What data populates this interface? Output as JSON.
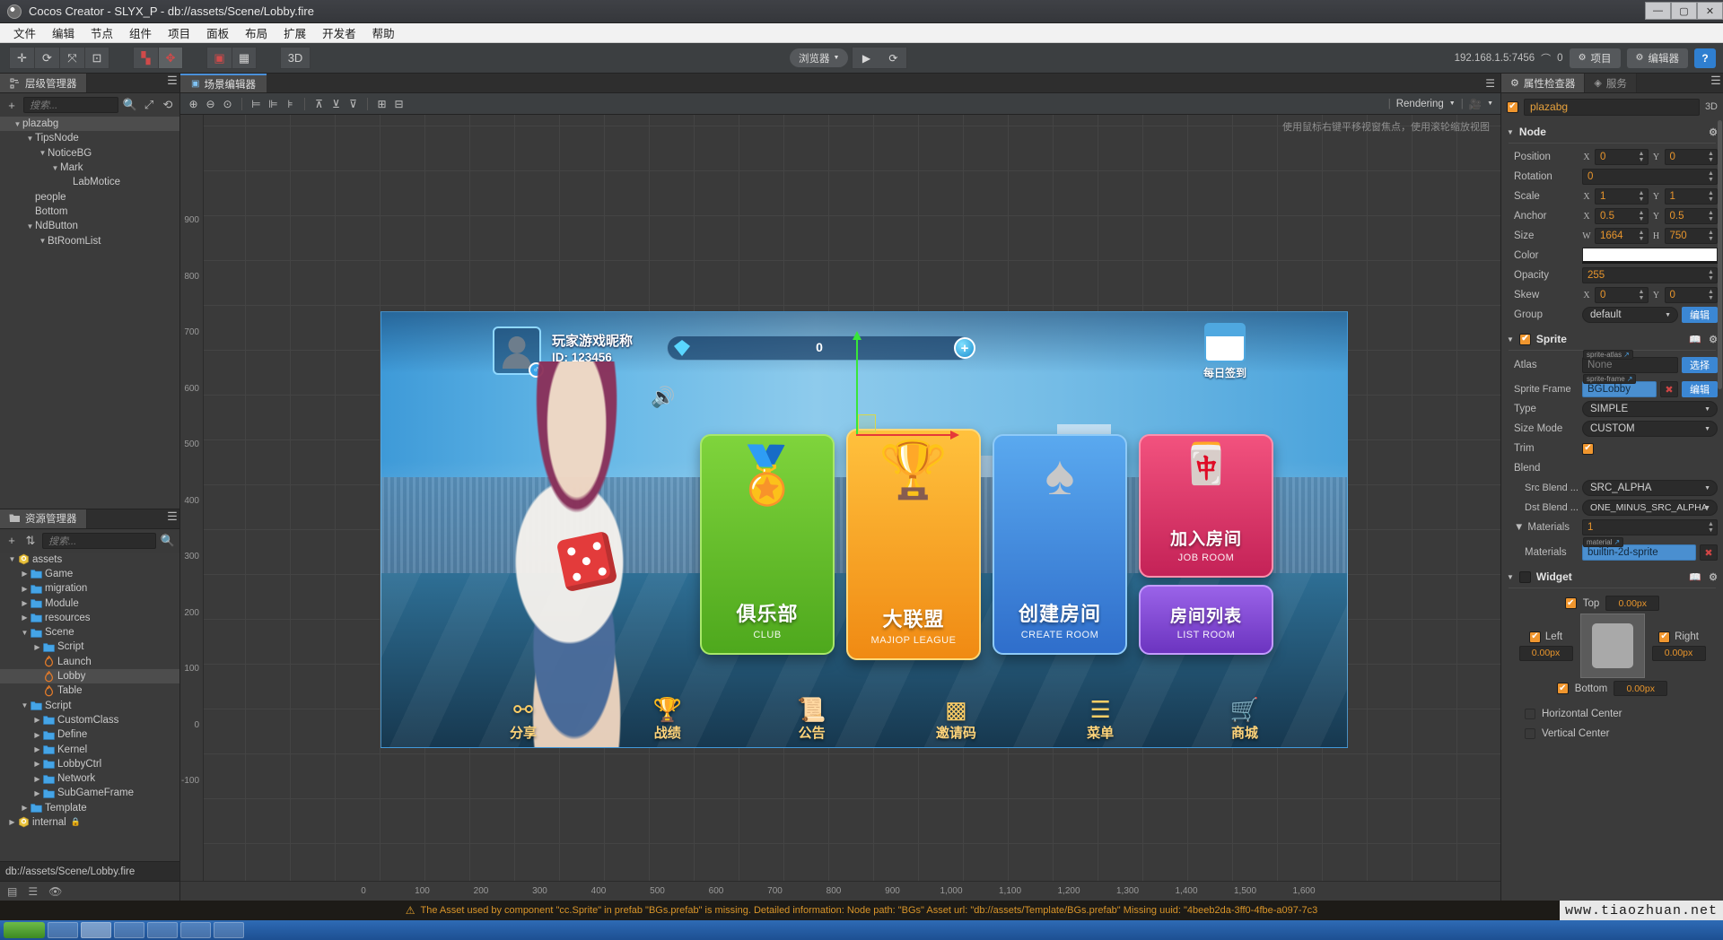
{
  "window": {
    "title": "Cocos Creator - SLYX_P - db://assets/Scene/Lobby.fire",
    "minimize": "—",
    "maximize": "▢",
    "close": "✕"
  },
  "menubar": [
    "文件",
    "编辑",
    "节点",
    "组件",
    "项目",
    "面板",
    "布局",
    "扩展",
    "开发者",
    "帮助"
  ],
  "toolbar": {
    "preview_target": "浏览器",
    "play_label": "▶",
    "refresh_label": "⟳",
    "mode_3d": "3D",
    "ip_text": "192.168.1.5:7456",
    "device_count": "0",
    "project_btn": "项目",
    "editor_btn": "编辑器",
    "help_btn": "?"
  },
  "hierarchy": {
    "tab_label": "层级管理器",
    "search_placeholder": "搜索...",
    "add_label": "+",
    "nodes": [
      {
        "label": "plazabg",
        "depth": 0,
        "arrow": "▼",
        "selected": true
      },
      {
        "label": "TipsNode",
        "depth": 1,
        "arrow": "▼",
        "selected": false
      },
      {
        "label": "NoticeBG",
        "depth": 2,
        "arrow": "▼",
        "selected": false
      },
      {
        "label": "Mark",
        "depth": 3,
        "arrow": "▼",
        "selected": false
      },
      {
        "label": "LabMotice",
        "depth": 4,
        "arrow": "",
        "selected": false
      },
      {
        "label": "people",
        "depth": 1,
        "arrow": "",
        "selected": false
      },
      {
        "label": "Bottom",
        "depth": 1,
        "arrow": "",
        "selected": false
      },
      {
        "label": "NdButton",
        "depth": 1,
        "arrow": "▼",
        "selected": false
      },
      {
        "label": "BtRoomList",
        "depth": 2,
        "arrow": "▼",
        "selected": false
      }
    ]
  },
  "assets": {
    "tab_label": "资源管理器",
    "search_placeholder": "搜索...",
    "items": [
      {
        "label": "assets",
        "depth": 0,
        "arrow": "▼",
        "icon": "db-icon",
        "selected": false
      },
      {
        "label": "Game",
        "depth": 1,
        "arrow": "▶",
        "icon": "folder-icon",
        "selected": false
      },
      {
        "label": "migration",
        "depth": 1,
        "arrow": "▶",
        "icon": "folder-icon",
        "selected": false
      },
      {
        "label": "Module",
        "depth": 1,
        "arrow": "▶",
        "icon": "folder-icon",
        "selected": false
      },
      {
        "label": "resources",
        "depth": 1,
        "arrow": "▶",
        "icon": "folder-icon",
        "selected": false
      },
      {
        "label": "Scene",
        "depth": 1,
        "arrow": "▼",
        "icon": "folder-icon",
        "selected": false
      },
      {
        "label": "Script",
        "depth": 2,
        "arrow": "▶",
        "icon": "folder-icon",
        "selected": false
      },
      {
        "label": "Launch",
        "depth": 2,
        "arrow": "",
        "icon": "fire-icon",
        "selected": false
      },
      {
        "label": "Lobby",
        "depth": 2,
        "arrow": "",
        "icon": "fire-icon",
        "selected": true
      },
      {
        "label": "Table",
        "depth": 2,
        "arrow": "",
        "icon": "fire-icon",
        "selected": false
      },
      {
        "label": "Script",
        "depth": 1,
        "arrow": "▼",
        "icon": "folder-icon",
        "selected": false
      },
      {
        "label": "CustomClass",
        "depth": 2,
        "arrow": "▶",
        "icon": "folder-icon",
        "selected": false
      },
      {
        "label": "Define",
        "depth": 2,
        "arrow": "▶",
        "icon": "folder-icon",
        "selected": false
      },
      {
        "label": "Kernel",
        "depth": 2,
        "arrow": "▶",
        "icon": "folder-icon",
        "selected": false
      },
      {
        "label": "LobbyCtrl",
        "depth": 2,
        "arrow": "▶",
        "icon": "folder-icon",
        "selected": false
      },
      {
        "label": "Network",
        "depth": 2,
        "arrow": "▶",
        "icon": "folder-icon",
        "selected": false
      },
      {
        "label": "SubGameFrame",
        "depth": 2,
        "arrow": "▶",
        "icon": "folder-icon",
        "selected": false
      },
      {
        "label": "Template",
        "depth": 1,
        "arrow": "▶",
        "icon": "folder-icon",
        "selected": false
      },
      {
        "label": "internal",
        "depth": 0,
        "arrow": "▶",
        "icon": "db-icon",
        "selected": false,
        "locked": true
      }
    ],
    "path_bar": "db://assets/Scene/Lobby.fire"
  },
  "scene": {
    "tab_label": "场景编辑器",
    "rendering_label": "Rendering",
    "hint": "使用鼠标右键平移视窗焦点，使用滚轮缩放视图",
    "ruler_y": [
      "900",
      "800",
      "700",
      "600",
      "500",
      "400",
      "300",
      "200",
      "100",
      "0",
      "-100"
    ],
    "ruler_x": [
      "0",
      "100",
      "200",
      "300",
      "400",
      "500",
      "600",
      "700",
      "800",
      "900",
      "1,000",
      "1,100",
      "1,200",
      "1,300",
      "1,400",
      "1,500",
      "1,600"
    ]
  },
  "game": {
    "player_name": "玩家游戏昵称",
    "player_id": "ID: 123456",
    "currency_value": "0",
    "plus": "+",
    "signin_label": "每日签到",
    "cards": [
      {
        "title": "俱乐部",
        "sub": "CLUB",
        "color": "#5fbb21",
        "art": "🏅"
      },
      {
        "title": "大联盟",
        "sub": "MAJIOP LEAGUE",
        "color": "#f29a18",
        "art": "🏆"
      },
      {
        "title": "创建房间",
        "sub": "CREATE ROOM",
        "color": "#3f7ed0",
        "art": "♠"
      },
      {
        "title": "加入房间",
        "sub": "JOB ROOM",
        "color": "#d62c5d",
        "art": "🀄"
      },
      {
        "title": "房间列表",
        "sub": "LIST ROOM",
        "color": "#7d40cc",
        "art": ""
      }
    ],
    "bottom_icons": [
      {
        "label": "分享",
        "glyph": "⚯"
      },
      {
        "label": "战绩",
        "glyph": "🏆"
      },
      {
        "label": "公告",
        "glyph": "📜"
      },
      {
        "label": "邀请码",
        "glyph": "▩"
      },
      {
        "label": "菜单",
        "glyph": "☰"
      },
      {
        "label": "商城",
        "glyph": "🛒"
      }
    ]
  },
  "inspector": {
    "tab_label": "属性检查器",
    "services_tab": "服务",
    "node_name": "plazabg",
    "badge_3d": "3D",
    "node_section": {
      "title": "Node",
      "rows": [
        {
          "label": "Position",
          "type": "xy",
          "x": "0",
          "y": "0"
        },
        {
          "label": "Rotation",
          "type": "single",
          "value": "0"
        },
        {
          "label": "Scale",
          "type": "xy",
          "x": "1",
          "y": "1"
        },
        {
          "label": "Anchor",
          "type": "xy",
          "x": "0.5",
          "y": "0.5"
        },
        {
          "label": "Size",
          "type": "wh",
          "w": "1664",
          "h": "750",
          "wlab": "W",
          "hlab": "H"
        },
        {
          "label": "Color",
          "type": "color",
          "value": "#ffffff"
        },
        {
          "label": "Opacity",
          "type": "single",
          "value": "255"
        },
        {
          "label": "Skew",
          "type": "xy",
          "x": "0",
          "y": "0"
        },
        {
          "label": "Group",
          "type": "dropbtn",
          "value": "default",
          "button": "编辑"
        }
      ]
    },
    "sprite_section": {
      "title": "Sprite",
      "atlas_label": "Atlas",
      "atlas_tag": "sprite-atlas",
      "atlas_value": "None",
      "atlas_button": "选择",
      "frame_label": "Sprite Frame",
      "frame_tag": "sprite-frame",
      "frame_value": "BGLobby",
      "frame_button": "编辑",
      "type_label": "Type",
      "type_value": "SIMPLE",
      "sizemode_label": "Size Mode",
      "sizemode_value": "CUSTOM",
      "trim_label": "Trim",
      "blend_label": "Blend",
      "src_blend_label": "Src Blend ...",
      "src_blend_value": "SRC_ALPHA",
      "dst_blend_label": "Dst Blend ...",
      "dst_blend_value": "ONE_MINUS_SRC_ALPHA",
      "materials_count_label": "Materials",
      "materials_count": "1",
      "materials_label": "Materials",
      "material_tag": "material",
      "material_value": "builtin-2d-sprite"
    },
    "widget_section": {
      "title": "Widget",
      "top_label": "Top",
      "top_value": "0.00px",
      "left_label": "Left",
      "left_value": "0.00px",
      "right_label": "Right",
      "right_value": "0.00px",
      "bottom_label": "Bottom",
      "bottom_value": "0.00px",
      "h_center_label": "Horizontal Center",
      "v_center_label": "Vertical Center"
    }
  },
  "statusbar": {
    "message": "The Asset used by component \"cc.Sprite\" in prefab \"BGs.prefab\" is missing. Detailed information: Node path: \"BGs\" Asset url: \"db://assets/Template/BGs.prefab\" Missing uuid: \"4beeb2da-3ff0-4fbe-a097-7c3",
    "watermark": "www.tiaozhuan.net"
  }
}
